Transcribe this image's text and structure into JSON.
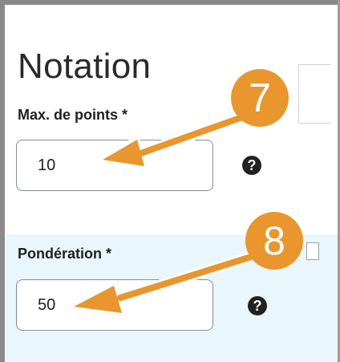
{
  "section": {
    "title": "Notation"
  },
  "max_points": {
    "label": "Max. de points",
    "required_mark": "*",
    "value": "10"
  },
  "weight": {
    "label": "Pondération",
    "required_mark": "*",
    "value": "50"
  },
  "help": {
    "glyph": "?"
  },
  "callouts": {
    "first": "7",
    "second": "8"
  },
  "colors": {
    "callout": "#e8962d",
    "panel": "#e9f6fc",
    "help_icon": "#222222"
  },
  "icons": {
    "help": "question-circle-icon"
  }
}
